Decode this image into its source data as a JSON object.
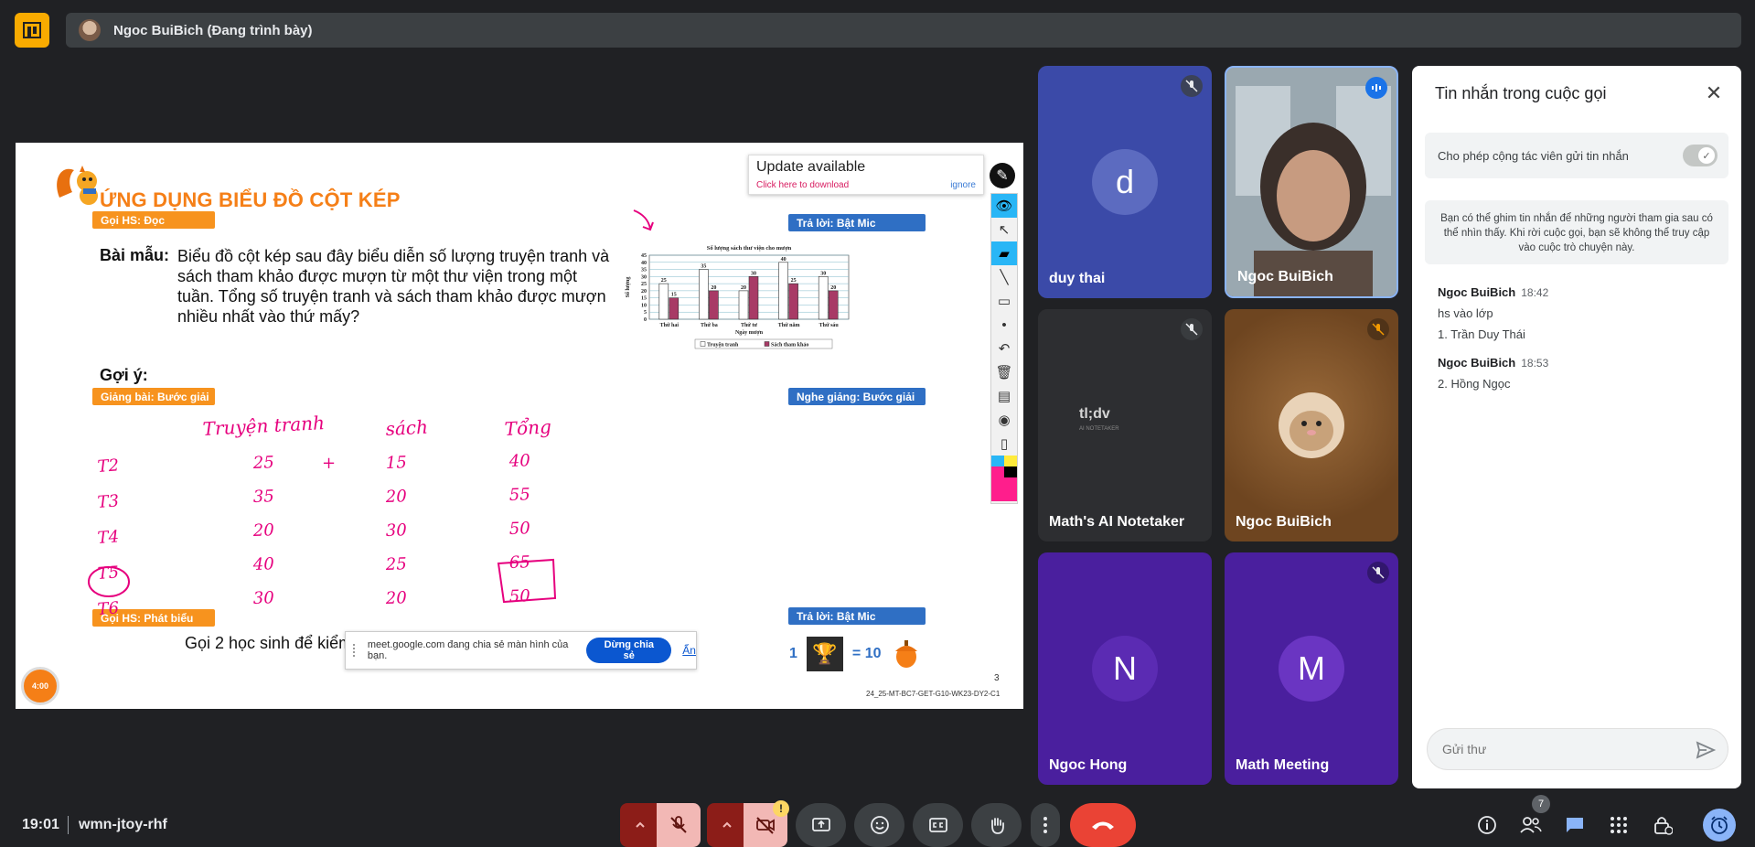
{
  "header": {
    "presenter": "Ngoc BuiBich (Đang trình bày)"
  },
  "slide": {
    "title": "ỨNG DỤNG BIỂU ĐỒ CỘT KÉP",
    "tag_doc": "Gọi HS: Đọc",
    "sample_label": "Bài mẫu:",
    "sample_text": "Biểu đồ cột kép sau đây biểu diễn số lượng truyện tranh và sách tham khảo được mượn từ một thư viện trong một tuần. Tổng số truyện tranh và sách tham khảo được mượn nhiều nhất vào thứ mấy?",
    "hint_label": "Gợi ý:",
    "tag_giang": "Giảng bài: Bước giải",
    "tag_phat_bieu": "Gọi HS: Phát biểu",
    "tag_tra_loi_1": "Trả lời: Bật Mic",
    "tag_nghe_giang": "Nghe giảng: Bước giải",
    "tag_tra_loi_2": "Trả lời: Bật Mic",
    "bottom_text": "Gọi 2 học sinh để kiểm",
    "reward_left": "1",
    "reward_right": "= 10",
    "page_number": "3",
    "code": "24_25-MT-BC7-GET-G10-WK23-DY2-C1",
    "timer": "4:00",
    "update_title": "Update available",
    "update_link": "Click here to download",
    "update_ignore": "ignore",
    "share_text": "meet.google.com đang chia sẻ màn hình của bạn.",
    "stop_share": "Dừng chia sẻ",
    "hide": "Ẩn",
    "handwriting": {
      "col1": "Truyện tranh",
      "col2": "sách",
      "col3": "Tổng",
      "rows": [
        {
          "day": "T2",
          "a": "25",
          "op": "+",
          "b": "15",
          "sum": "40"
        },
        {
          "day": "T3",
          "a": "35",
          "op": "",
          "b": "20",
          "sum": "55"
        },
        {
          "day": "T4",
          "a": "20",
          "op": "",
          "b": "30",
          "sum": "50"
        },
        {
          "day": "T5",
          "a": "40",
          "op": "",
          "b": "25",
          "sum": "65"
        },
        {
          "day": "T6",
          "a": "30",
          "op": "",
          "b": "20",
          "sum": "50"
        }
      ]
    }
  },
  "chart_data": {
    "type": "bar",
    "title": "Số lượng sách thư viện cho mượn",
    "xlabel": "Ngày mượn",
    "ylabel": "Số lượng",
    "categories": [
      "Thứ hai",
      "Thứ ba",
      "Thứ tư",
      "Thứ năm",
      "Thứ sáu"
    ],
    "series": [
      {
        "name": "Truyện tranh",
        "values": [
          25,
          35,
          20,
          40,
          30
        ],
        "color": "#ffffff"
      },
      {
        "name": "Sách tham khảo",
        "values": [
          15,
          20,
          30,
          25,
          20
        ],
        "color": "#a83a66"
      }
    ],
    "ylim": [
      0,
      45
    ],
    "yticks": [
      0,
      5,
      10,
      15,
      20,
      25,
      30,
      35,
      40,
      45
    ],
    "grid": true,
    "legend": "bottom"
  },
  "participants": [
    {
      "name": "duy thai",
      "initial": "d",
      "muted": true,
      "color": "#3b4aa8"
    },
    {
      "name": "Ngoc BuiBich",
      "muted": false,
      "speaking": true,
      "video": true
    },
    {
      "name": "Math's AI Notetaker",
      "muted": true,
      "logo": "tl;dv",
      "logo_sub": "AI NOTETAKER"
    },
    {
      "name": "Ngoc BuiBich",
      "muted": true,
      "color": "#7a4a1c"
    },
    {
      "name": "Ngoc Hong",
      "initial": "N",
      "muted": false,
      "color": "#4a1f9e"
    },
    {
      "name": "Math Meeting",
      "initial": "M",
      "muted": true,
      "color": "#4a1f9e"
    }
  ],
  "chat": {
    "title": "Tin nhắn trong cuộc gọi",
    "permission": "Cho phép cộng tác viên gửi tin nhắn",
    "note": "Bạn có thể ghim tin nhắn để những người tham gia sau có thể nhìn thấy. Khi rời cuộc gọi, bạn sẽ không thể truy cập vào cuộc trò chuyện này.",
    "messages": [
      {
        "sender": "Ngoc BuiBich",
        "time": "18:42",
        "lines": [
          "hs vào lớp",
          "1. Trần Duy Thái"
        ]
      },
      {
        "sender": "Ngoc BuiBich",
        "time": "18:53",
        "lines": [
          "2. Hồng Ngọc"
        ]
      }
    ],
    "input_placeholder": "Gửi thư"
  },
  "footer": {
    "time": "19:01",
    "meeting_code": "wmn-jtoy-rhf",
    "people_count": "7",
    "camera_warning": "!"
  },
  "colors": {
    "background": "#202124",
    "hangup": "#ea4335",
    "accent_blue": "#8ab4f8",
    "slide_orange": "#f7931e",
    "slide_blue": "#2f6fc4"
  }
}
